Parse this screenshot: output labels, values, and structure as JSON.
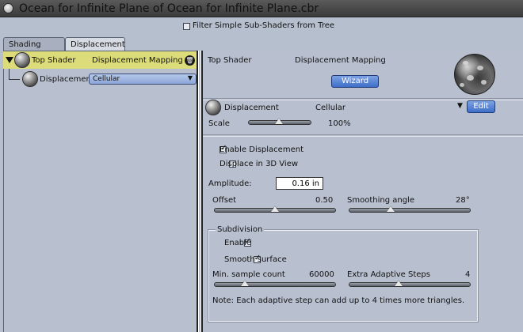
{
  "window": {
    "title": "Ocean for Infinite Plane of Ocean for Infinite Plane.cbr"
  },
  "filter": {
    "label": "Filter Simple Sub-Shaders from Tree",
    "checked": false
  },
  "tabs": [
    {
      "label": "Shading",
      "active": false
    },
    {
      "label": "Displacement",
      "active": true
    }
  ],
  "tree": {
    "top_shader": {
      "label": "Top Shader",
      "type": "Displacement Mapping"
    },
    "child": {
      "label": "Displacement",
      "select_value": "Cellular"
    }
  },
  "header": {
    "shader_label": "Top Shader",
    "shader_type": "Displacement Mapping",
    "wizard_label": "Wizard"
  },
  "displacement_shader": {
    "label": "Displacement",
    "value": "Cellular",
    "edit_label": "Edit",
    "collapse_icon": "»",
    "scale_label": "Scale",
    "scale_value": "100%"
  },
  "options": {
    "enable_displacement": {
      "label": "Enable Displacement",
      "checked": true
    },
    "displace_3d": {
      "label": "Displace in 3D View",
      "checked": false
    },
    "amplitude_label": "Amplitude:",
    "amplitude_value": "0.16 in",
    "offset": {
      "label": "Offset",
      "value": "0.50",
      "fraction": 0.5
    },
    "smoothing": {
      "label": "Smoothing angle",
      "value": "28°",
      "fraction": 0.3
    }
  },
  "subdivision": {
    "legend": "Subdivision",
    "enable": {
      "label": "Enable",
      "checked": true
    },
    "smooth": {
      "label": "Smooth surface",
      "checked": true
    },
    "min_sample": {
      "label": "Min. sample count",
      "value": "60000",
      "fraction": 0.25
    },
    "extra_steps": {
      "label": "Extra Adaptive Steps",
      "value": "4",
      "fraction": 0.4
    },
    "note": "Note: Each adaptive step can add up to 4 times more triangles."
  },
  "icons": {
    "trash": "trash-icon",
    "tree_toggle": "disclosure-triangle-icon",
    "sphere": "shader-preview-icon"
  }
}
